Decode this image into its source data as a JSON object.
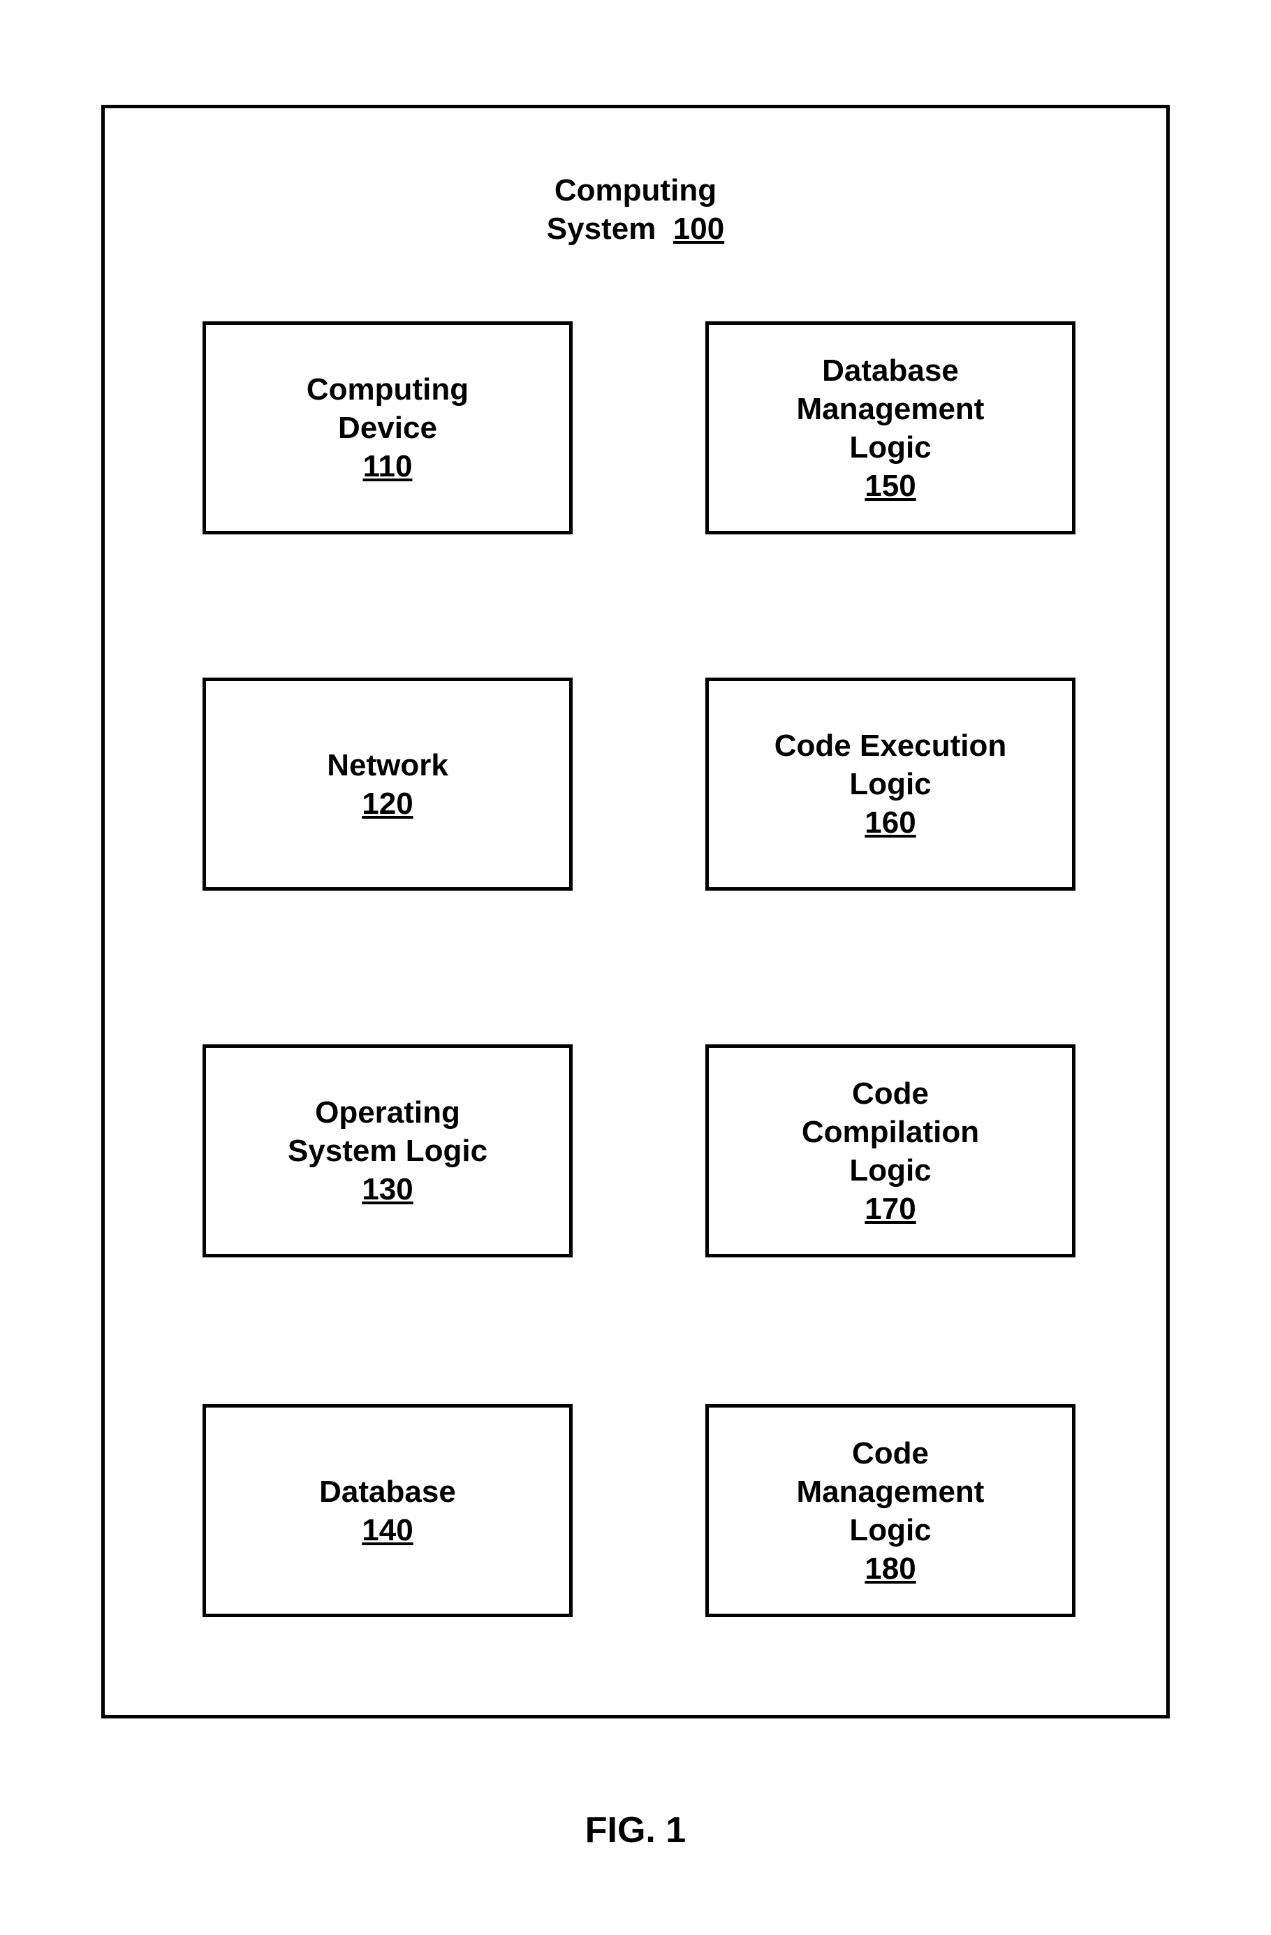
{
  "diagram": {
    "title": {
      "line1": "Computing",
      "line2": "System",
      "ref": "100"
    },
    "blocks": [
      {
        "id": "computing-device",
        "line1": "Computing",
        "line2": "Device",
        "ref": "110"
      },
      {
        "id": "database-management-logic",
        "line1": "Database",
        "line2": "Management",
        "line3": "Logic",
        "ref": "150"
      },
      {
        "id": "network",
        "line1": "Network",
        "ref": "120"
      },
      {
        "id": "code-execution-logic",
        "line1": "Code Execution",
        "line2": "Logic",
        "ref": "160"
      },
      {
        "id": "operating-system-logic",
        "line1": "Operating",
        "line2": "System Logic",
        "ref": "130"
      },
      {
        "id": "code-compilation-logic",
        "line1": "Code",
        "line2": "Compilation",
        "line3": "Logic",
        "ref": "170"
      },
      {
        "id": "database",
        "line1": "Database",
        "ref": "140"
      },
      {
        "id": "code-management-logic",
        "line1": "Code",
        "line2": "Management",
        "line3": "Logic",
        "ref": "180"
      }
    ],
    "caption": "FIG. 1"
  }
}
